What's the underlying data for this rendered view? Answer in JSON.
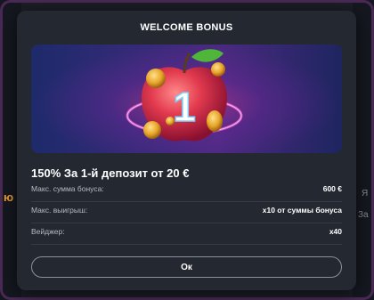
{
  "modal": {
    "title": "WELCOME BONUS",
    "headline": "150% За 1-й депозит от 20 €",
    "rows": [
      {
        "label": "Макс. сумма бонуса:",
        "value": "600 €"
      },
      {
        "label": "Макс. выигрыш:",
        "value": "x10 от суммы бонуса"
      },
      {
        "label": "Вейджер:",
        "value": "x40"
      }
    ],
    "ok_label": "Ок",
    "banner_badge": "1"
  },
  "background": {
    "left_fragments": [
      "ю"
    ],
    "right_fragments": [
      "Я",
      "За"
    ]
  },
  "colors": {
    "modal_bg": "#242830",
    "page_bg": "#14161c",
    "apple_red": "#e23a4e",
    "coin_gold": "#e8a62a",
    "button_border": "#8b909c"
  }
}
